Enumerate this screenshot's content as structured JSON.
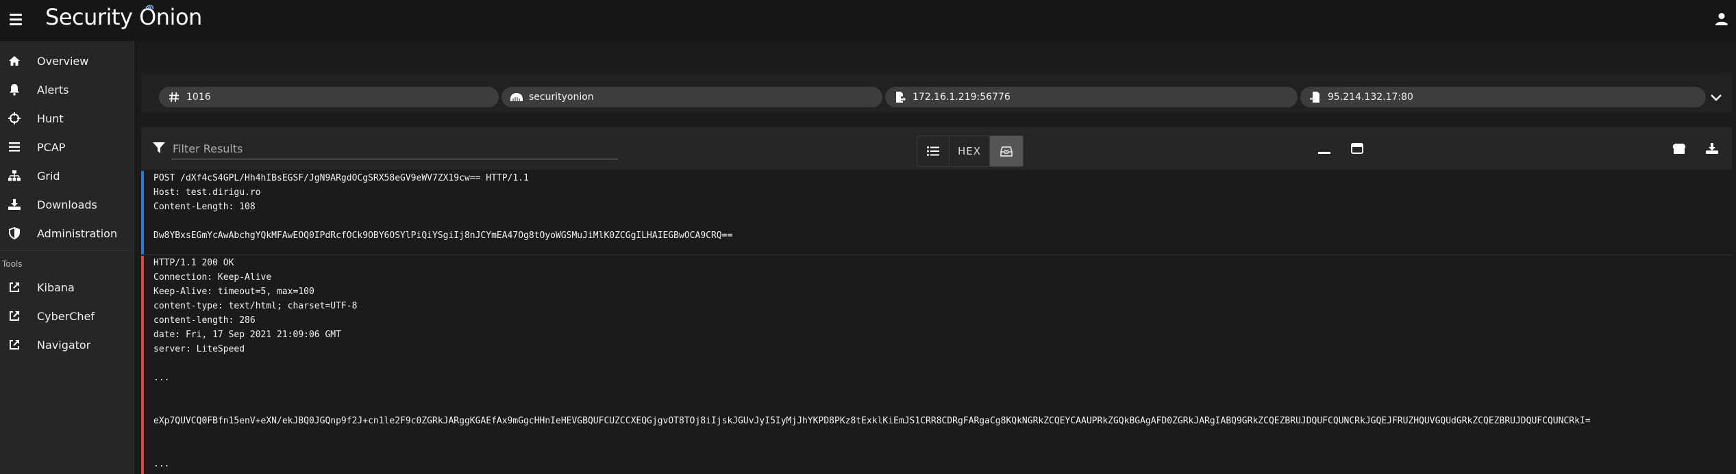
{
  "app": {
    "brand": "Security Onion"
  },
  "sidebar": {
    "items": [
      {
        "label": "Overview",
        "icon": "home-icon"
      },
      {
        "label": "Alerts",
        "icon": "bell-icon"
      },
      {
        "label": "Hunt",
        "icon": "crosshairs-icon"
      },
      {
        "label": "PCAP",
        "icon": "bars-icon"
      },
      {
        "label": "Grid",
        "icon": "sitemap-icon"
      },
      {
        "label": "Downloads",
        "icon": "download-icon"
      },
      {
        "label": "Administration",
        "icon": "shield-icon"
      }
    ],
    "tools_label": "Tools",
    "tools": [
      {
        "label": "Kibana",
        "icon": "external-link-icon"
      },
      {
        "label": "CyberChef",
        "icon": "external-link-icon"
      },
      {
        "label": "Navigator",
        "icon": "external-link-icon"
      }
    ]
  },
  "chips": [
    {
      "value": "1016",
      "icon": "hash-icon"
    },
    {
      "value": "securityonion",
      "icon": "sensor-icon"
    },
    {
      "value": "172.16.1.219:56776",
      "icon": "source-icon"
    },
    {
      "value": "95.214.132.17:80",
      "icon": "destination-icon"
    }
  ],
  "toolbar": {
    "filter_placeholder": "Filter Results",
    "hex_label": "HEX"
  },
  "request_lines": [
    "POST /dXf4cS4GPL/Hh4hIBsEGSF/JgN9ARgdOCgSRX58eGV9eWV7ZX19cw== HTTP/1.1",
    "Host: test.dirigu.ro",
    "Content-Length: 108",
    "",
    "Dw8YBxsEGmYcAwAbchgYQkMFAwEOQ0IPdRcfOCk9OBY6OSYlPiQiYSgiIj8nJCYmEA47Og8tOyoWGSMuJiMlK0ZCGgILHAIEGBwOCA9CRQ=="
  ],
  "response_lines": [
    "HTTP/1.1 200 OK",
    "Connection: Keep-Alive",
    "Keep-Alive: timeout=5, max=100",
    "content-type: text/html; charset=UTF-8",
    "content-length: 286",
    "date: Fri, 17 Sep 2021 21:09:06 GMT",
    "server: LiteSpeed",
    "",
    "...",
    "",
    "",
    "eXp7QUVCQ0FBfn15enV+eXN/ekJBQ0JGQnp9f2J+cn1le2F9c0ZGRkJARggKGAEfAx9mGgcHHnIeHEVGBQUFCUZCCXEQGjgvOT8TOj8iIjskJGUvJyI5IyMjJhYKPD8PKz8tExklKiEmJS1CRR8CDRgFARgaCg8KQkNGRkZCQEYCAAUPRkZGQkBGAgAFD0ZGRkJARgIABQ9GRkZCQEZBRUJDQUFCQUNCRkJGQEJFRUZHQUVGQUdGRkZCQEZBRUJDQUFCQUNCRkI=",
    "",
    "",
    "..."
  ]
}
